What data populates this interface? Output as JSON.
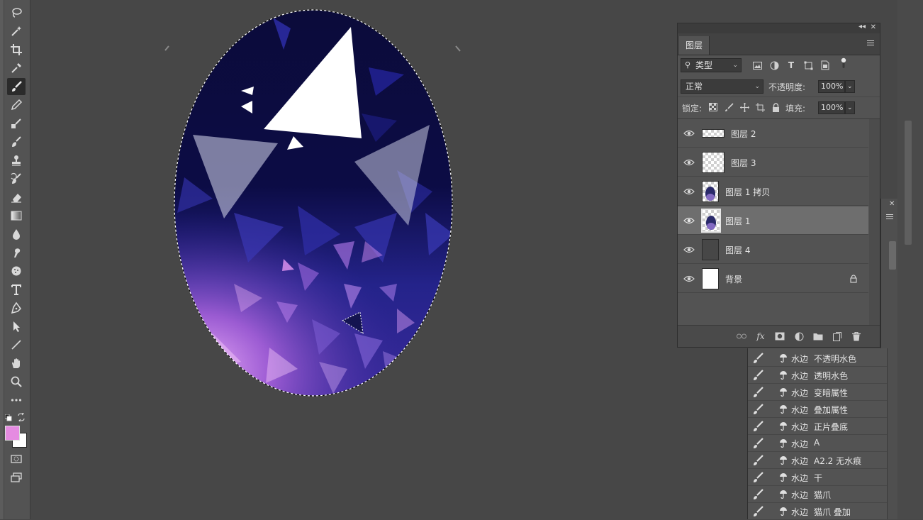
{
  "colors": {
    "workspace": "#474747",
    "panel": "#535353",
    "foreground_swatch": "#e58be1",
    "background_swatch": "#ffffff",
    "selected_layer": "#6e6e6e"
  },
  "toolbar": {
    "tools": [
      {
        "name": "lasso-tool-icon"
      },
      {
        "name": "magic-wand-tool-icon"
      },
      {
        "name": "crop-tool-icon"
      },
      {
        "name": "eyedropper-tool-icon"
      },
      {
        "name": "brush-tool-icon",
        "active": true
      },
      {
        "name": "pencil-tool-icon"
      },
      {
        "name": "mixer-brush-tool-icon"
      },
      {
        "name": "healing-brush-tool-icon"
      },
      {
        "name": "clone-stamp-tool-icon"
      },
      {
        "name": "history-brush-tool-icon"
      },
      {
        "name": "eraser-tool-icon"
      },
      {
        "name": "gradient-tool-icon"
      },
      {
        "name": "blur-tool-icon"
      },
      {
        "name": "smudge-tool-icon"
      },
      {
        "name": "sponge-tool-icon"
      },
      {
        "name": "type-tool-icon"
      },
      {
        "name": "pen-tool-icon"
      },
      {
        "name": "path-selection-tool-icon"
      },
      {
        "name": "line-tool-icon"
      },
      {
        "name": "hand-tool-icon"
      },
      {
        "name": "zoom-tool-icon"
      },
      {
        "name": "more-tools-icon"
      }
    ]
  },
  "layers_panel": {
    "tab_label": "图层",
    "filter_label": "类型",
    "blend_mode": "正常",
    "opacity_label": "不透明度:",
    "opacity_value": "100%",
    "lock_label": "锁定:",
    "fill_label": "填充:",
    "fill_value": "100%",
    "layers": [
      {
        "name": "图层 2",
        "thumb": "transparent-wide",
        "selected": false
      },
      {
        "name": "图层 3",
        "thumb": "transparent",
        "selected": false
      },
      {
        "name": "图层 1 拷贝",
        "thumb": "image",
        "selected": false
      },
      {
        "name": "图层 1",
        "thumb": "image",
        "selected": true
      },
      {
        "name": "图层 4",
        "thumb": "dark",
        "selected": false
      },
      {
        "name": "背景",
        "thumb": "white",
        "selected": false,
        "locked": true
      }
    ]
  },
  "brush_panel": {
    "items": [
      {
        "group": "水边",
        "name": "不透明水色"
      },
      {
        "group": "水边",
        "name": "透明水色"
      },
      {
        "group": "水边",
        "name": "变暗属性"
      },
      {
        "group": "水边",
        "name": "叠加属性"
      },
      {
        "group": "水边",
        "name": "正片叠底"
      },
      {
        "group": "水边",
        "name": "A"
      },
      {
        "group": "水边",
        "name": "A2.2 无水痕"
      },
      {
        "group": "水边",
        "name": "干"
      },
      {
        "group": "水边",
        "name": "猫爪"
      },
      {
        "group": "水边",
        "name": "猫爪 叠加"
      }
    ]
  }
}
